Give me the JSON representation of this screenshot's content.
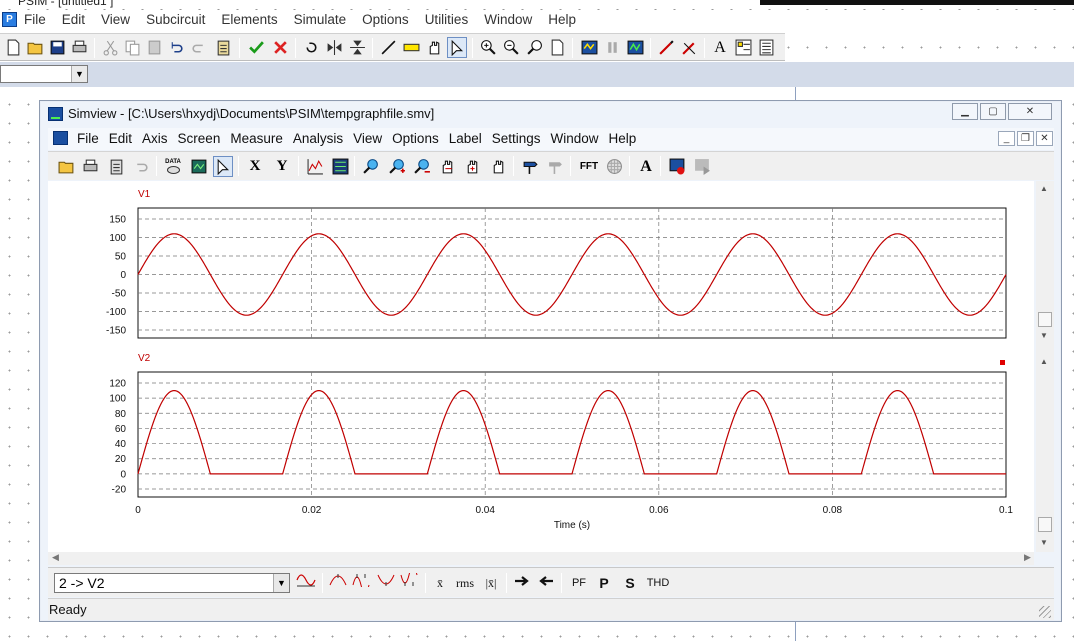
{
  "psim": {
    "title": "PSIM - [untitled1 ]",
    "menu": [
      "File",
      "Edit",
      "View",
      "Subcircuit",
      "Elements",
      "Simulate",
      "Options",
      "Utilities",
      "Window",
      "Help"
    ],
    "combo_value": ""
  },
  "simview": {
    "title": "Simview - [C:\\Users\\hxydj\\Documents\\PSIM\\tempgraphfile.smv]",
    "menu": [
      "File",
      "Edit",
      "Axis",
      "Screen",
      "Measure",
      "Analysis",
      "View",
      "Options",
      "Label",
      "Settings",
      "Window",
      "Help"
    ],
    "toolbar_text": {
      "data_label": "DATA",
      "x_label": "X",
      "y_label": "Y",
      "fft_label": "FFT",
      "text_label": "A"
    },
    "curve_select": "2 -> V2",
    "bottom_buttons": {
      "avg": "x̄",
      "rms": "rms",
      "abs_avg": "|x̄|",
      "pf": "PF",
      "p": "P",
      "s": "S",
      "thd": "THD"
    },
    "status": "Ready"
  },
  "chart_data": [
    {
      "type": "line",
      "title": "V1",
      "color": "#c00000",
      "ylim": [
        -150,
        150
      ],
      "yticks": [
        150,
        100,
        50,
        0,
        -50,
        -100,
        -150
      ],
      "xlim": [
        0,
        0.1
      ],
      "series": [
        {
          "name": "V1",
          "function": "110*sin(2*pi*60*t)",
          "amplitude": 110,
          "frequency_hz": 60
        }
      ]
    },
    {
      "type": "line",
      "title": "V2",
      "color": "#c00000",
      "ylim": [
        -20,
        120
      ],
      "yticks": [
        120,
        100,
        80,
        60,
        40,
        20,
        0,
        -20
      ],
      "xlim": [
        0,
        0.1
      ],
      "xticks": [
        0,
        0.02,
        0.04,
        0.06,
        0.08,
        0.1
      ],
      "xtick_labels": [
        "0",
        "0.02",
        "0.04",
        "0.06",
        "0.08",
        "0.1"
      ],
      "xlabel": "Time (s)",
      "series": [
        {
          "name": "V2",
          "function": "max(0, 110*sin(2*pi*60*t))",
          "amplitude": 110,
          "frequency_hz": 60
        }
      ]
    }
  ]
}
